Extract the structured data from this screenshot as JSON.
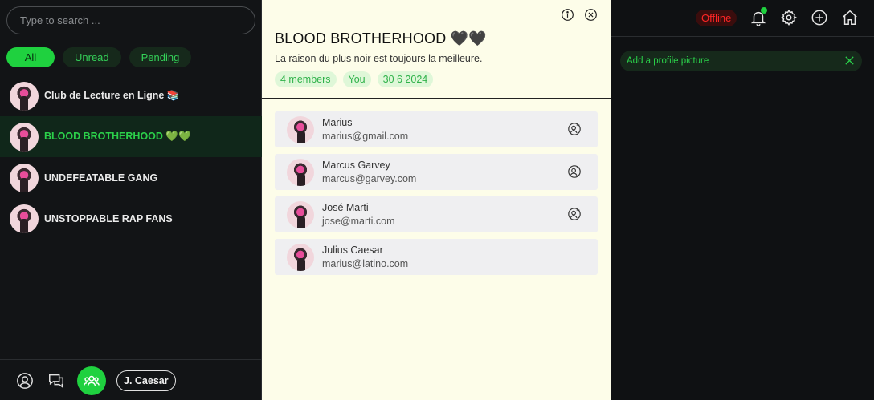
{
  "sidebar": {
    "search_placeholder": "Type to search ...",
    "filters": [
      "All",
      "Unread",
      "Pending"
    ],
    "groups": [
      {
        "name": "Club de Lecture en Ligne 📚"
      },
      {
        "name": "BLOOD BROTHERHOOD 💚💚"
      },
      {
        "name": "UNDEFEATABLE GANG"
      },
      {
        "name": "UNSTOPPABLE RAP FANS"
      }
    ],
    "footer": {
      "user_label": "J. Caesar"
    }
  },
  "group_panel": {
    "title": "BLOOD BROTHERHOOD 🖤🖤",
    "description": "La raison du plus noir est toujours la meilleure.",
    "tags": [
      "4 members",
      "You",
      "30 6 2024"
    ],
    "members": [
      {
        "name": "Marius",
        "email": "marius@gmail.com"
      },
      {
        "name": "Marcus Garvey",
        "email": "marcus@garvey.com"
      },
      {
        "name": "José Marti",
        "email": "jose@marti.com"
      },
      {
        "name": "Julius Caesar",
        "email": "marius@latino.com"
      }
    ]
  },
  "right_panel": {
    "status": "Offline",
    "notice": "Add a profile picture"
  },
  "colors": {
    "accent": "#1fd13f",
    "offline_text": "#ff2626",
    "panel_bg": "#fdfde9",
    "dark_bg": "#121416"
  }
}
